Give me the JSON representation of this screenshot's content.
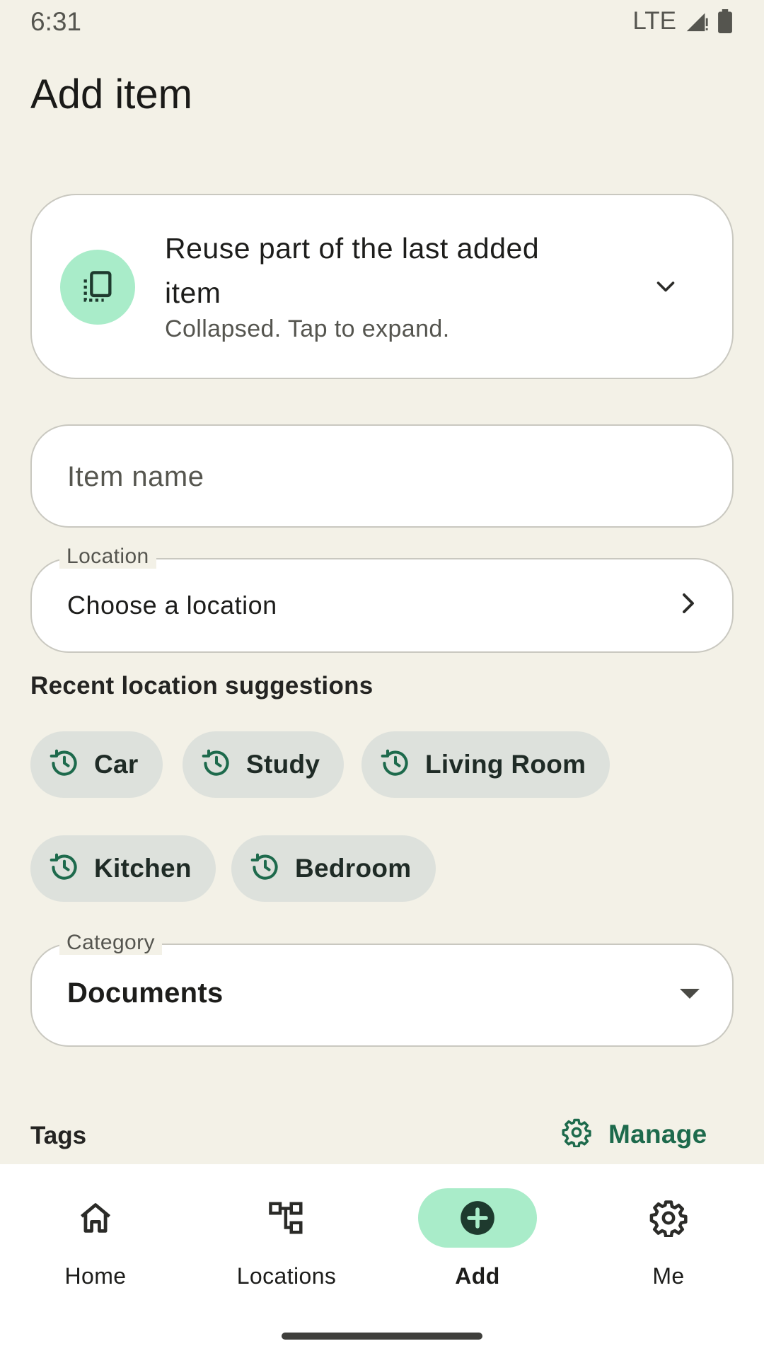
{
  "status_bar": {
    "time": "6:31",
    "network": "LTE"
  },
  "page": {
    "title": "Add item"
  },
  "reuse_card": {
    "title": "Reuse part of the last added item",
    "subtitle": "Collapsed. Tap to expand.",
    "icon": "copy-document-icon"
  },
  "item_name": {
    "placeholder": "Item name",
    "value": ""
  },
  "location": {
    "label": "Location",
    "value": "Choose a location"
  },
  "suggestions": {
    "heading": "Recent location suggestions",
    "chips": [
      {
        "label": "Car"
      },
      {
        "label": "Study"
      },
      {
        "label": "Living Room"
      },
      {
        "label": "Kitchen"
      },
      {
        "label": "Bedroom"
      }
    ]
  },
  "category": {
    "label": "Category",
    "value": "Documents"
  },
  "tags": {
    "heading": "Tags",
    "manage_label": "Manage"
  },
  "bottom_nav": {
    "items": [
      {
        "label": "Home",
        "icon": "home-icon",
        "active": false
      },
      {
        "label": "Locations",
        "icon": "hierarchy-icon",
        "active": false
      },
      {
        "label": "Add",
        "icon": "add-circle-icon",
        "active": true
      },
      {
        "label": "Me",
        "icon": "gear-icon",
        "active": false
      }
    ]
  },
  "colors": {
    "background": "#f3f1e7",
    "accent_container": "#a9ecc9",
    "accent_text": "#1d6a4c",
    "chip_background": "#dde1dc",
    "surface": "#ffffff"
  }
}
